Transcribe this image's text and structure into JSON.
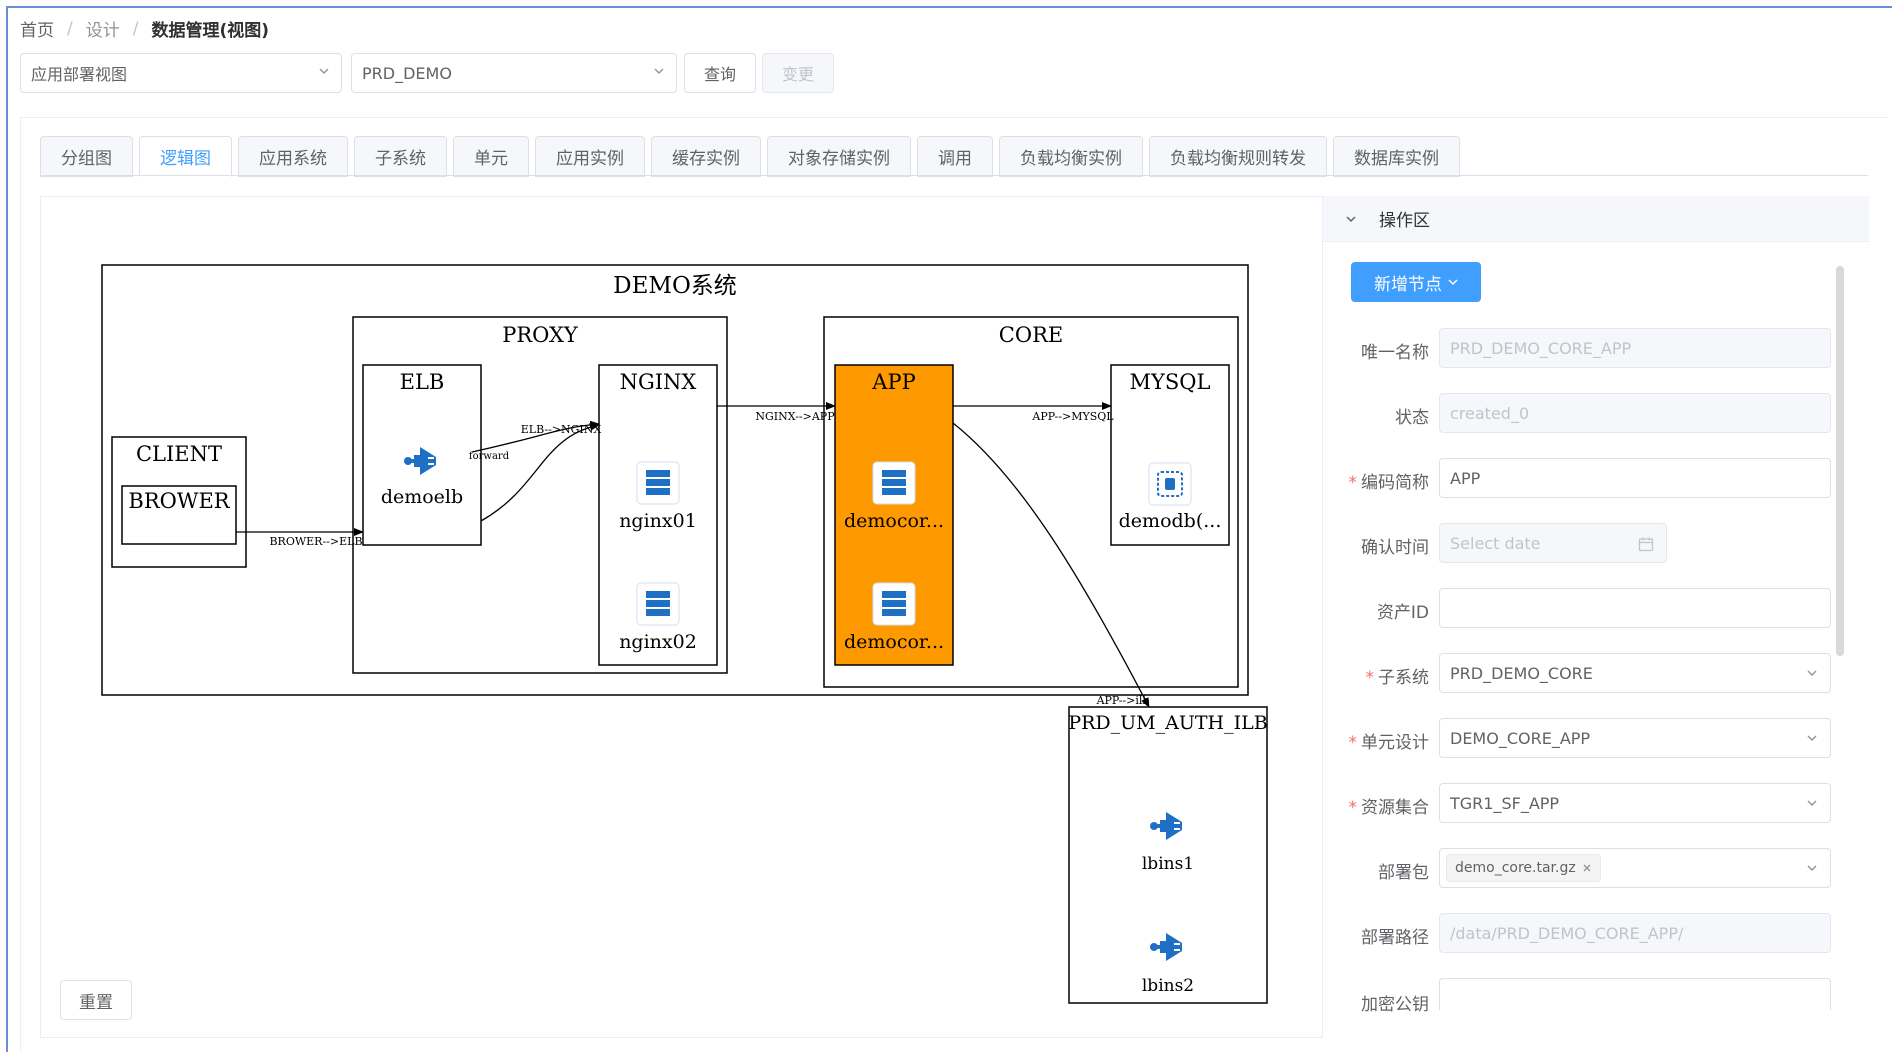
{
  "breadcrumb": {
    "home": "首页",
    "design": "设计",
    "current": "数据管理(视图)"
  },
  "toolbar": {
    "view_select": "应用部署视图",
    "system_select": "PRD_DEMO",
    "query_label": "查询",
    "change_label": "变更"
  },
  "tabs": [
    "分组图",
    "逻辑图",
    "应用系统",
    "子系统",
    "单元",
    "应用实例",
    "缓存实例",
    "对象存储实例",
    "调用",
    "负载均衡实例",
    "负载均衡规则转发",
    "数据库实例"
  ],
  "active_tab": "逻辑图",
  "diagram": {
    "system_title": "DEMO系统",
    "client": "CLIENT",
    "brower": "BROWER",
    "proxy": "PROXY",
    "elb": "ELB",
    "demoelb": "demoelb",
    "nginx": "NGINX",
    "nginx01": "nginx01",
    "nginx02": "nginx02",
    "core": "CORE",
    "app": "APP",
    "democor1": "democor...",
    "democor2": "democor...",
    "mysql": "MYSQL",
    "demodb": "demodb(...",
    "auth": "PRD_UM_AUTH_ILB",
    "lbins1": "lbins1",
    "lbins2": "lbins2",
    "edge_brower_elb": "BROWER-->ELB",
    "edge_elb_nginx": "ELB-->NGINX",
    "edge_forward": "forward",
    "edge_nginx_app": "NGINX-->APP",
    "edge_app_mysql": "APP-->MYSQL",
    "edge_app_ilb": "APP-->ilb",
    "app_color": "#ff9900",
    "icon_color": "#1f6fc5"
  },
  "reset_label": "重置",
  "panel": {
    "title": "操作区",
    "add_node": "新增节点",
    "fields": {
      "unique_name": {
        "label": "唯一名称",
        "value": "PRD_DEMO_CORE_APP"
      },
      "status": {
        "label": "状态",
        "value": "created_0"
      },
      "code": {
        "label": "编码简称",
        "value": "APP"
      },
      "confirm_time": {
        "label": "确认时间",
        "placeholder": "Select date"
      },
      "asset_id": {
        "label": "资产ID",
        "value": ""
      },
      "subsystem": {
        "label": "子系统",
        "value": "PRD_DEMO_CORE"
      },
      "unit_design": {
        "label": "单元设计",
        "value": "DEMO_CORE_APP"
      },
      "resource_set": {
        "label": "资源集合",
        "value": "TGR1_SF_APP"
      },
      "package": {
        "label": "部署包",
        "tag": "demo_core.tar.gz"
      },
      "deploy_path": {
        "label": "部署路径",
        "value": "/data/PRD_DEMO_CORE_APP/"
      },
      "pubkey": {
        "label": "加密公钥",
        "value": ""
      }
    }
  }
}
